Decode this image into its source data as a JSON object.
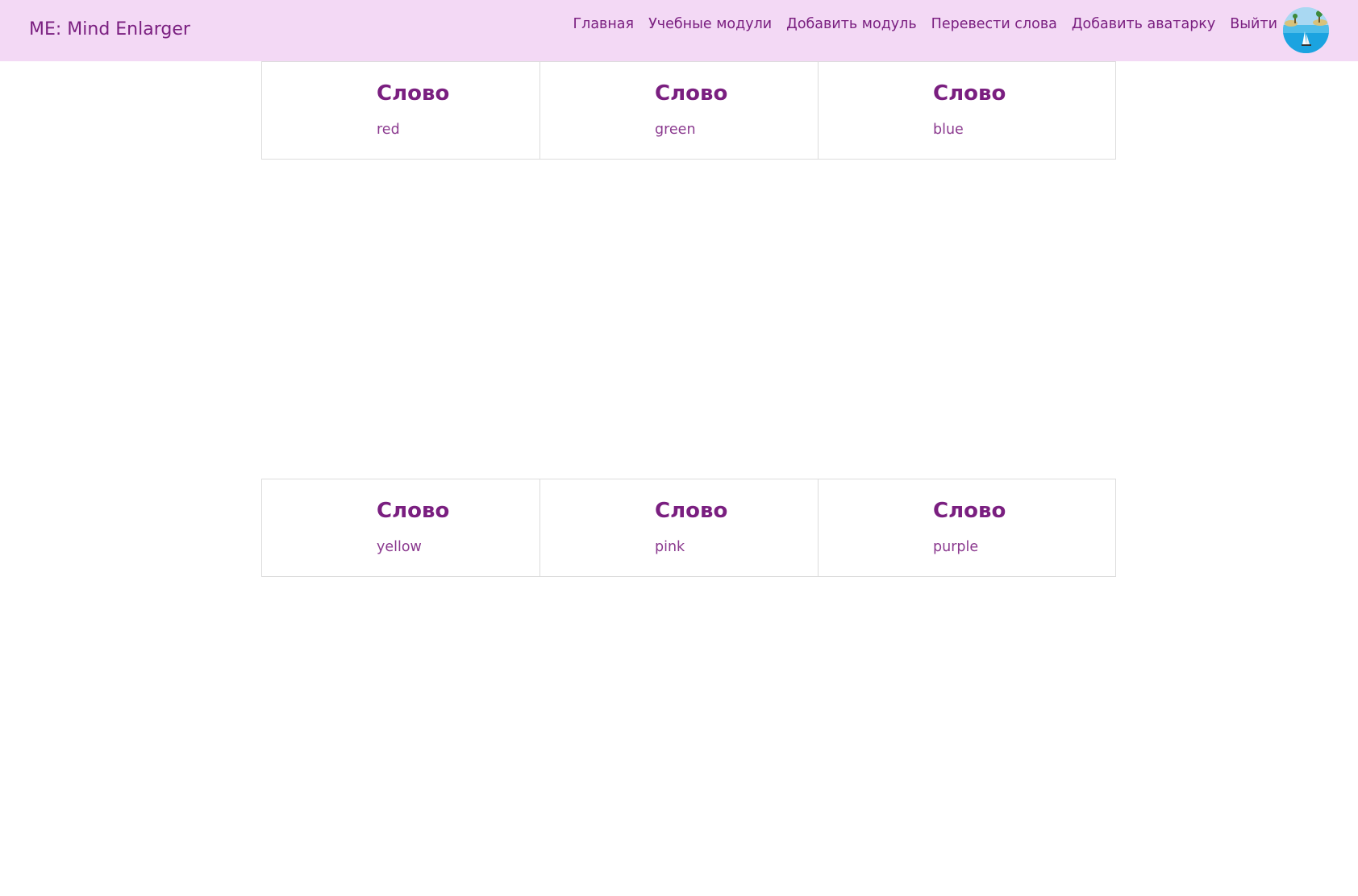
{
  "navbar": {
    "brand": "ME: Mind Enlarger",
    "links": [
      {
        "label": "Главная"
      },
      {
        "label": "Учебные модули"
      },
      {
        "label": "Добавить модуль"
      },
      {
        "label": "Перевести слова"
      },
      {
        "label": "Добавить аватарку"
      },
      {
        "label": "Выйти"
      }
    ]
  },
  "cards": [
    {
      "title": "Слово",
      "word": "red"
    },
    {
      "title": "Слово",
      "word": "green"
    },
    {
      "title": "Слово",
      "word": "blue"
    },
    {
      "title": "Слово",
      "word": "yellow"
    },
    {
      "title": "Слово",
      "word": "pink"
    },
    {
      "title": "Слово",
      "word": "purple"
    }
  ],
  "colors": {
    "navbar_bg": "#f3d9f5",
    "accent": "#7a1f80",
    "word_text": "#8b3a8f",
    "card_border": "#dcdcdc"
  }
}
